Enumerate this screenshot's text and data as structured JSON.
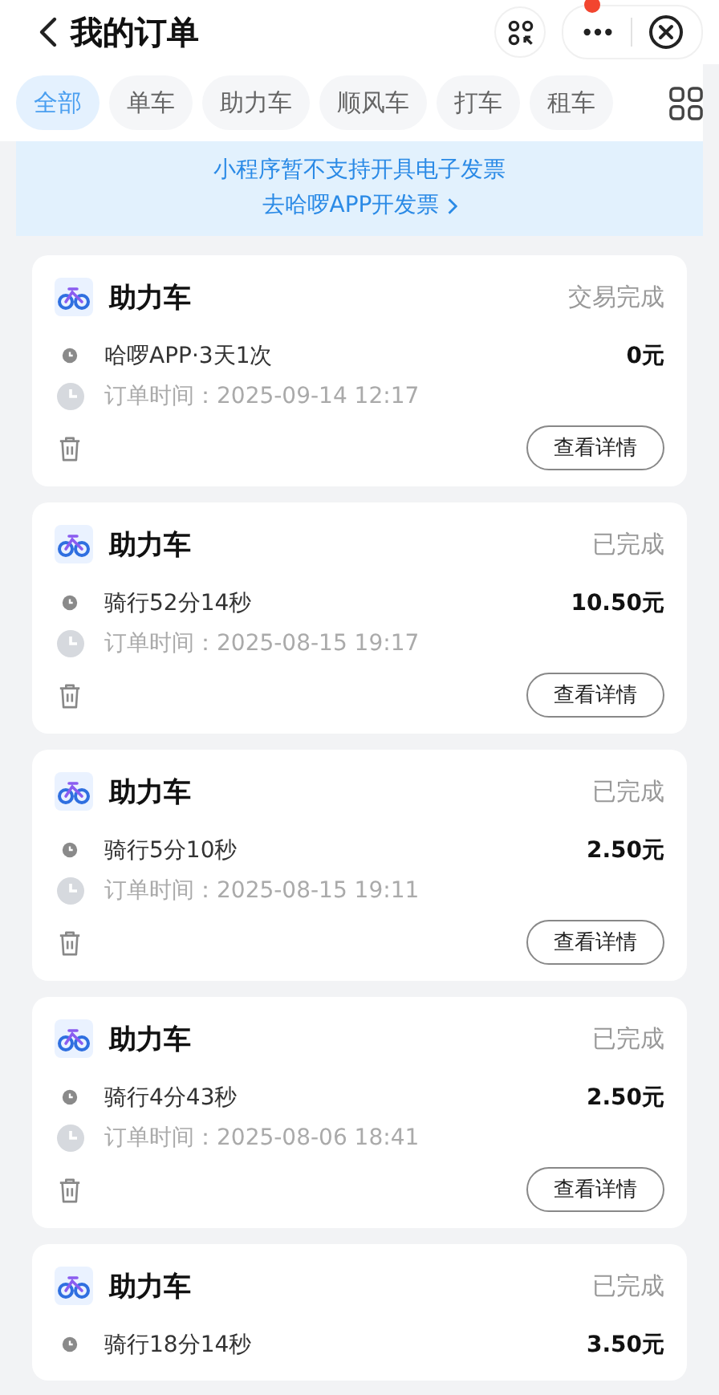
{
  "header": {
    "title": "我的订单",
    "menu_badge": true
  },
  "tabs": [
    {
      "label": "全部",
      "selected": true
    },
    {
      "label": "单车",
      "selected": false
    },
    {
      "label": "助力车",
      "selected": false
    },
    {
      "label": "顺风车",
      "selected": false
    },
    {
      "label": "打车",
      "selected": false
    },
    {
      "label": "租车",
      "selected": false
    }
  ],
  "notice": {
    "line1": "小程序暂不支持开具电子发票",
    "link": "去哈啰APP开发票"
  },
  "orders": [
    {
      "title": "助力车",
      "status": "交易完成",
      "summary": "哈啰APP·3天1次",
      "price": "0元",
      "time": "订单时间：2025-09-14 12:17",
      "action": "查看详情"
    },
    {
      "title": "助力车",
      "status": "已完成",
      "summary": "骑行52分14秒",
      "price": "10.50元",
      "time": "订单时间：2025-08-15 19:17",
      "action": "查看详情"
    },
    {
      "title": "助力车",
      "status": "已完成",
      "summary": "骑行5分10秒",
      "price": "2.50元",
      "time": "订单时间：2025-08-15 19:11",
      "action": "查看详情"
    },
    {
      "title": "助力车",
      "status": "已完成",
      "summary": "骑行4分43秒",
      "price": "2.50元",
      "time": "订单时间：2025-08-06 18:41",
      "action": "查看详情"
    },
    {
      "title": "助力车",
      "status": "已完成",
      "summary": "骑行18分14秒",
      "price": "3.50元"
    }
  ]
}
